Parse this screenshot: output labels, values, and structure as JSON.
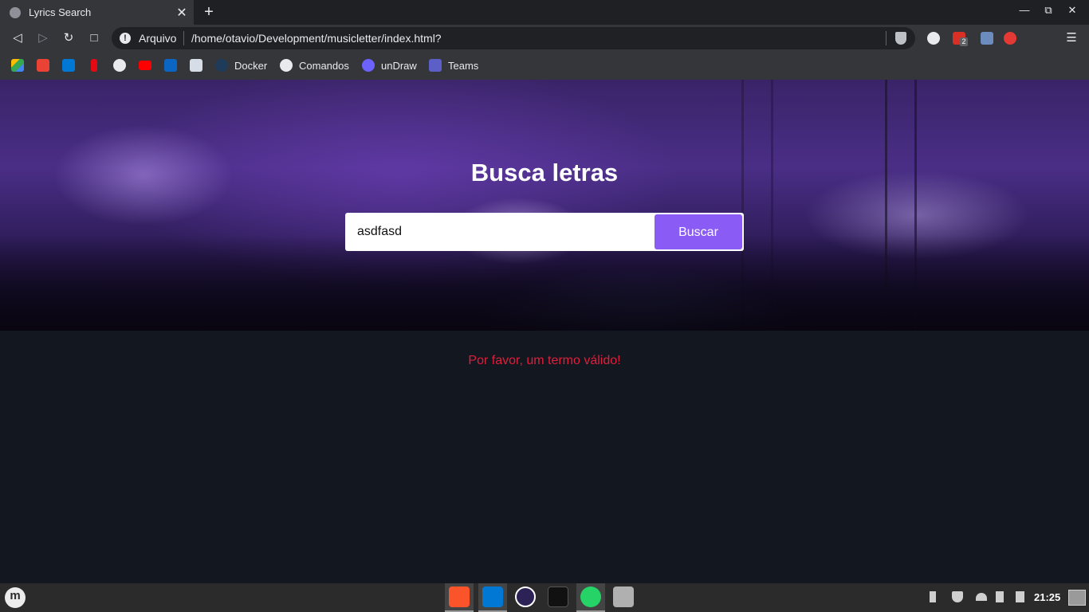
{
  "browser": {
    "tab_title": "Lyrics Search",
    "tab_close_glyph": "✕",
    "new_tab_glyph": "+",
    "scheme_label": "Arquivo",
    "url": "/home/otavio/Development/musicletter/index.html?",
    "extension_badge": "2"
  },
  "bookmarks": [
    {
      "label": "Docker",
      "icon": "docker-icon",
      "color": "#1d63ed"
    },
    {
      "label": "Comandos",
      "icon": "github-icon",
      "color": "#e8eaed"
    },
    {
      "label": "unDraw",
      "icon": "undraw-icon",
      "color": "#6c63ff"
    },
    {
      "label": "Teams",
      "icon": "teams-icon",
      "color": "#5b5fc7"
    }
  ],
  "page": {
    "title": "Busca letras",
    "search_value": "asdfasd",
    "search_button": "Buscar",
    "error_message": "Por favor, um termo válido!",
    "accent_color": "#8a5cf5",
    "error_color": "#e21e3a"
  },
  "taskbar": {
    "clock": "21:25"
  }
}
